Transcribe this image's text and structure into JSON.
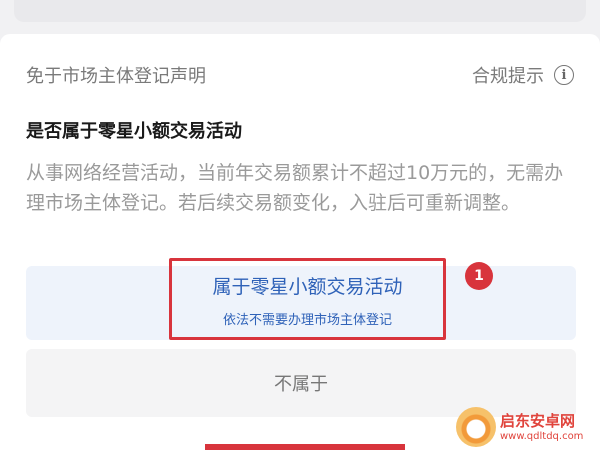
{
  "header": {
    "title": "免于市场主体登记声明",
    "compliance_link": "合规提示",
    "info_icon": "info-icon",
    "info_glyph": "i"
  },
  "question": "是否属于零星小额交易活动",
  "description": "从事网络经营活动，当前年交易额累计不超过10万元的，无需办理市场主体登记。若后续交易额变化，入驻后可重新调整。",
  "options": {
    "yes_title": "属于零星小额交易活动",
    "yes_subtitle": "依法不需要办理市场主体登记",
    "no_title": "不属于"
  },
  "annotation": {
    "badge_number": "1",
    "highlight_color": "#d8343c"
  },
  "watermark": {
    "title": "启东安卓网",
    "url": "www.qdltdq.com"
  },
  "colors": {
    "accent_blue": "#2f62b8",
    "option_bg": "#eef3fb",
    "muted_text": "#9a9a9a"
  }
}
